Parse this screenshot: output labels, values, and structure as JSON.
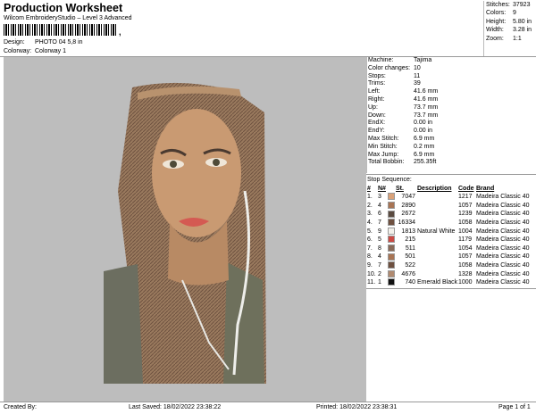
{
  "header": {
    "title": "Production Worksheet",
    "subtitle": "Wilcom EmbroideryStudio – Level 3 Advanced",
    "barcode_mark": ",",
    "design_label": "Design:",
    "design_value": "PHOTO 04 5,8 in",
    "colorway_label": "Colorway:",
    "colorway_value": "Colorway 1"
  },
  "stats": [
    {
      "k": "Stitches:",
      "v": "37923"
    },
    {
      "k": "Colors:",
      "v": "9"
    },
    {
      "k": "Height:",
      "v": "5.80 in"
    },
    {
      "k": "Width:",
      "v": "3.28 in"
    },
    {
      "k": "Zoom:",
      "v": "1:1"
    }
  ],
  "machine": [
    {
      "k": "Machine:",
      "v": "Tajima"
    },
    {
      "k": "Color changes:",
      "v": "10"
    },
    {
      "k": "Stops:",
      "v": "11"
    },
    {
      "k": "Trims:",
      "v": "39"
    },
    {
      "k": "Left:",
      "v": "41.6 mm"
    },
    {
      "k": "Right:",
      "v": "41.6 mm"
    },
    {
      "k": "Up:",
      "v": "73.7 mm"
    },
    {
      "k": "Down:",
      "v": "73.7 mm"
    },
    {
      "k": "EndX:",
      "v": "0.00 in"
    },
    {
      "k": "EndY:",
      "v": "0.00 in"
    },
    {
      "k": "Max Stitch:",
      "v": "6.9 mm"
    },
    {
      "k": "Min Stitch:",
      "v": "0.2 mm"
    },
    {
      "k": "Max Jump:",
      "v": "6.9 mm"
    },
    {
      "k": "Total Bobbin:",
      "v": "255.35ft"
    }
  ],
  "sequence": {
    "title": "Stop Sequence:",
    "headers": [
      "#",
      "N#",
      "St.",
      "Description",
      "Code",
      "Brand"
    ],
    "rows": [
      {
        "i": "1.",
        "n": "3",
        "color": "#d9a27a",
        "st": "7047",
        "desc": "",
        "code": "1217",
        "brand": "Madeira Classic 40"
      },
      {
        "i": "2.",
        "n": "4",
        "color": "#a87454",
        "st": "2890",
        "desc": "",
        "code": "1057",
        "brand": "Madeira Classic 40"
      },
      {
        "i": "3.",
        "n": "6",
        "color": "#5a4a40",
        "st": "2672",
        "desc": "",
        "code": "1239",
        "brand": "Madeira Classic 40"
      },
      {
        "i": "4.",
        "n": "7",
        "color": "#6e5040",
        "st": "16334",
        "desc": "",
        "code": "1058",
        "brand": "Madeira Classic 40"
      },
      {
        "i": "5.",
        "n": "9",
        "color": "#f2f0ea",
        "st": "1813",
        "desc": "Natural White",
        "code": "1004",
        "brand": "Madeira Classic 40"
      },
      {
        "i": "6.",
        "n": "5",
        "color": "#cc4a44",
        "st": "215",
        "desc": "",
        "code": "1179",
        "brand": "Madeira Classic 40"
      },
      {
        "i": "7.",
        "n": "8",
        "color": "#8a6a58",
        "st": "511",
        "desc": "",
        "code": "1054",
        "brand": "Madeira Classic 40"
      },
      {
        "i": "8.",
        "n": "4",
        "color": "#a87454",
        "st": "501",
        "desc": "",
        "code": "1057",
        "brand": "Madeira Classic 40"
      },
      {
        "i": "9.",
        "n": "7",
        "color": "#6e5040",
        "st": "522",
        "desc": "",
        "code": "1058",
        "brand": "Madeira Classic 40"
      },
      {
        "i": "10.",
        "n": "2",
        "color": "#b08a70",
        "st": "4676",
        "desc": "",
        "code": "1328",
        "brand": "Madeira Classic 40"
      },
      {
        "i": "11.",
        "n": "1",
        "color": "#111111",
        "st": "740",
        "desc": "Emerald Black",
        "code": "1000",
        "brand": "Madeira Classic 40"
      }
    ]
  },
  "footer": {
    "created": "Created By:",
    "saved": "Last Saved:  18/02/2022 23:38:22",
    "printed": "Printed:  18/02/2022 23:38:31",
    "page": "Page 1 of 1"
  }
}
